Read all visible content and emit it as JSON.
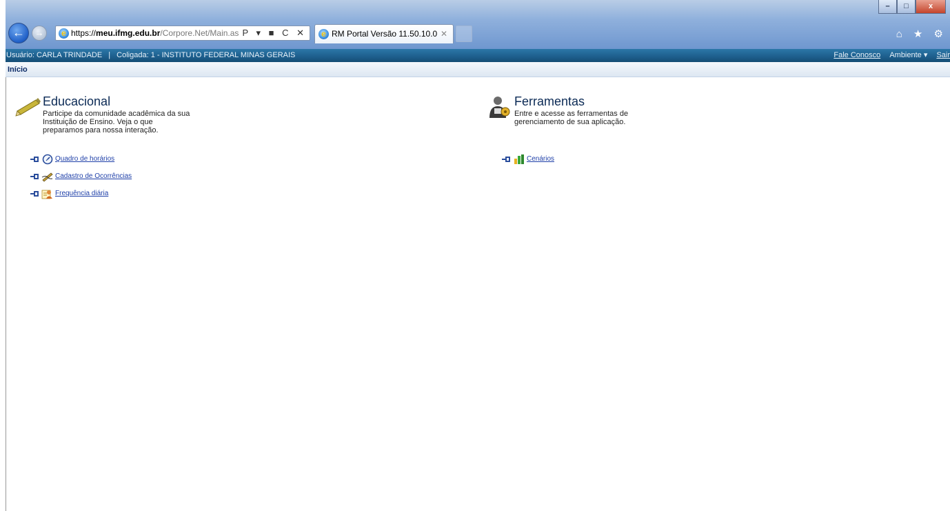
{
  "browser": {
    "address": {
      "scheme": "https://",
      "host": "meu.ifmg.edu.br",
      "path": "/Corpore.Net/Main.asp",
      "actions": "Ρ ▾ ■ C ✕"
    },
    "tab_title": "RM Portal Versão 11.50.10.0",
    "tab_close": "✕",
    "window_controls": [
      "–",
      "□",
      "x"
    ],
    "toolbar_icons": "⌂ ★ ⚙"
  },
  "userbar": {
    "user_label": "Usuário:",
    "user_name": "CARLA TRINDADE",
    "separator": "|",
    "coligada_label": "Coligada:",
    "coligada_value": "1 - INSTITUTO FEDERAL MINAS GERAIS",
    "contact_link": "Fale Conosco",
    "environment_menu": "Ambiente ▾",
    "exit_link": "Sair"
  },
  "breadcrumb": {
    "current": "Início"
  },
  "educacional": {
    "title": "Educacional",
    "description": "Participe da comunidade acadêmica da sua Instituição de Ensino. Veja o que preparamos para nossa interação.",
    "links": [
      {
        "label": "Quadro de horários",
        "icon": "clock-icon"
      },
      {
        "label": "Cadastro de Ocorrências",
        "icon": "pen-icon"
      },
      {
        "label": "Frequência diária",
        "icon": "attendance-icon"
      }
    ]
  },
  "ferramentas": {
    "title": "Ferramentas",
    "description": "Entre e acesse as ferramentas de gerenciamento de sua aplicação.",
    "links": [
      {
        "label": "Cenários",
        "icon": "bar-chart-icon"
      }
    ]
  },
  "colors": {
    "userbar": "#1d5e8c",
    "link": "#1e3fa8",
    "title": "#0b2a55"
  }
}
